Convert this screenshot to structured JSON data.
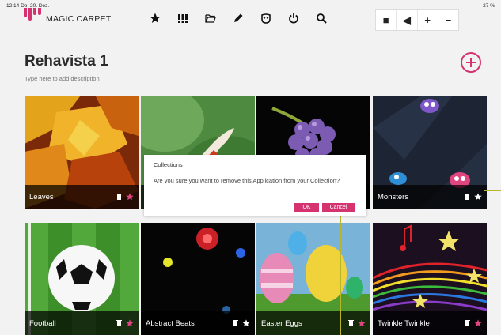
{
  "status": {
    "time": "12:14  Do. 20. Dez.",
    "battery": "27 %"
  },
  "app": {
    "name": "MAGIC CARPET",
    "accent": "#d5336f"
  },
  "toolbar": [
    {
      "icon": "star-icon",
      "name": "favorites-button"
    },
    {
      "icon": "grid-icon",
      "name": "apps-button"
    },
    {
      "icon": "folder-open-icon",
      "name": "collections-button"
    },
    {
      "icon": "pencil-icon",
      "name": "edit-button"
    },
    {
      "icon": "mask-icon",
      "name": "profile-button"
    },
    {
      "icon": "power-icon",
      "name": "power-button"
    },
    {
      "icon": "search-icon",
      "name": "search-button"
    }
  ],
  "window_controls": [
    "■",
    "◀",
    "+",
    "−"
  ],
  "collection": {
    "title": "Rehavista 1",
    "description_placeholder": "Type here to add description"
  },
  "tiles": [
    {
      "label": "Leaves",
      "star_color": "#e0457f"
    },
    {
      "label": "",
      "star_color": "#e0457f"
    },
    {
      "label": "",
      "star_color": "#e0457f"
    },
    {
      "label": "Monsters",
      "star_color": "#ffffff"
    },
    {
      "label": "Football",
      "star_color": "#e0457f"
    },
    {
      "label": "Abstract Beats",
      "star_color": "#ffffff"
    },
    {
      "label": "Easter Eggs",
      "star_color": "#e0457f"
    },
    {
      "label": "Twinkle Twinkle",
      "star_color": "#e0457f"
    }
  ],
  "dialog": {
    "title": "Collections",
    "message": "Are you sure you want to remove this Application from your Collection?",
    "ok_label": "OK",
    "cancel_label": "Cancel"
  }
}
